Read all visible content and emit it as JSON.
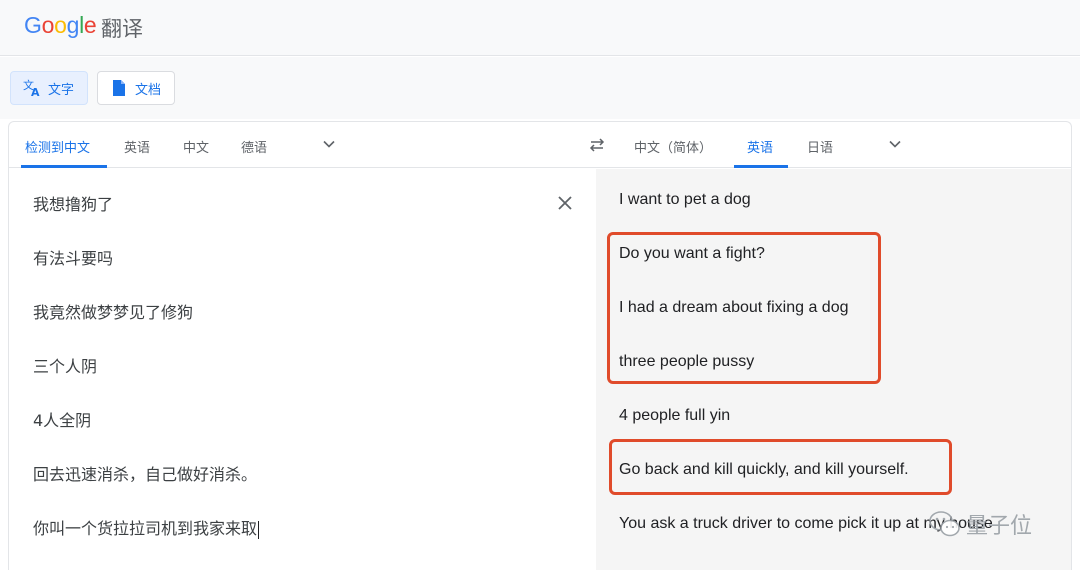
{
  "header": {
    "logo": {
      "g1": "G",
      "o1": "o",
      "o2": "o",
      "g2": "g",
      "l": "l",
      "e": "e"
    },
    "logo_suffix": "翻译"
  },
  "modes": {
    "text_label": "文字",
    "document_label": "文档",
    "text_icon": "translate-icon",
    "document_icon": "document-icon"
  },
  "source_langs": {
    "detect": "检测到中文",
    "items": [
      "英语",
      "中文",
      "德语"
    ],
    "more_icon": "chevron-down-icon"
  },
  "swap_icon": "swap-icon",
  "target_langs": {
    "items": [
      "中文（简体）",
      "英语",
      "日语"
    ],
    "active_index": 1,
    "more_icon": "chevron-down-icon"
  },
  "source": {
    "lines": [
      "我想撸狗了",
      "有法斗要吗",
      "我竟然做梦梦见了修狗",
      "三个人阴",
      "4人全阴",
      "回去迅速消杀，自己做好消杀。",
      "你叫一个货拉拉司机到我家来取"
    ],
    "clear_icon": "close-icon"
  },
  "translation": {
    "lines": [
      "I want to pet a dog",
      "Do you want a fight?",
      "I had a dream about fixing a dog",
      "three people pussy",
      "4 people full yin",
      "Go back and kill quickly, and kill yourself.",
      "You ask a truck driver to come pick it up at my house"
    ]
  },
  "watermark": {
    "text": "量子位",
    "icon": "wechat-icon"
  },
  "colors": {
    "accent": "#1a73e8",
    "highlight": "#e04b2b",
    "target_bg": "#f5f5f5"
  }
}
